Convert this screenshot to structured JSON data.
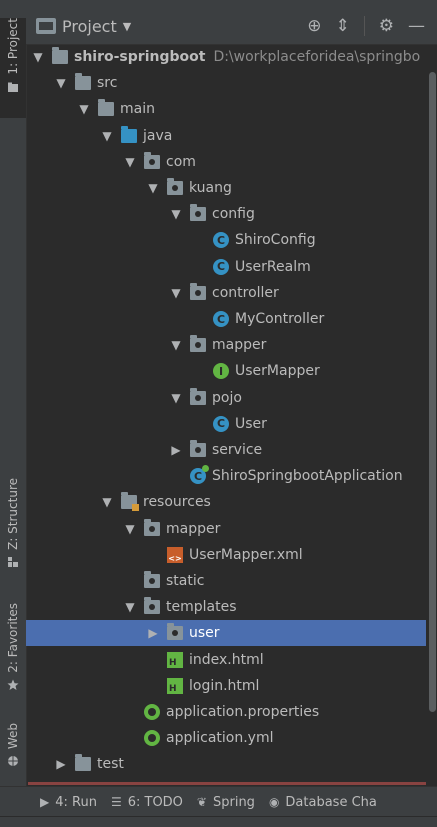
{
  "header": {
    "title": "Project",
    "actions": [
      "locate-icon",
      "collapse-icon",
      "settings-icon",
      "hide-icon"
    ]
  },
  "left_tabs": [
    {
      "label": "1: Project",
      "icon": "folder-icon"
    },
    {
      "label": "Z: Structure",
      "icon": "structure-icon"
    },
    {
      "label": "2: Favorites",
      "icon": "star-icon"
    },
    {
      "label": "Web",
      "icon": "globe-icon"
    }
  ],
  "tree": [
    {
      "label": "shiro-springboot",
      "extra": "D:\\workplaceforidea\\springbo",
      "depth": 0,
      "arrow": "open",
      "icon": "project"
    },
    {
      "label": "src",
      "depth": 1,
      "arrow": "open",
      "icon": "folder"
    },
    {
      "label": "main",
      "depth": 2,
      "arrow": "open",
      "icon": "folder"
    },
    {
      "label": "java",
      "depth": 3,
      "arrow": "open",
      "icon": "src"
    },
    {
      "label": "com",
      "depth": 4,
      "arrow": "open",
      "icon": "pkg"
    },
    {
      "label": "kuang",
      "depth": 5,
      "arrow": "open",
      "icon": "pkg"
    },
    {
      "label": "config",
      "depth": 6,
      "arrow": "open",
      "icon": "pkg"
    },
    {
      "label": "ShiroConfig",
      "depth": 7,
      "arrow": "none",
      "icon": "class"
    },
    {
      "label": "UserRealm",
      "depth": 7,
      "arrow": "none",
      "icon": "class"
    },
    {
      "label": "controller",
      "depth": 6,
      "arrow": "open",
      "icon": "pkg"
    },
    {
      "label": "MyController",
      "depth": 7,
      "arrow": "none",
      "icon": "class"
    },
    {
      "label": "mapper",
      "depth": 6,
      "arrow": "open",
      "icon": "pkg"
    },
    {
      "label": "UserMapper",
      "depth": 7,
      "arrow": "none",
      "icon": "interface"
    },
    {
      "label": "pojo",
      "depth": 6,
      "arrow": "open",
      "icon": "pkg"
    },
    {
      "label": "User",
      "depth": 7,
      "arrow": "none",
      "icon": "class"
    },
    {
      "label": "service",
      "depth": 6,
      "arrow": "closed",
      "icon": "pkg"
    },
    {
      "label": "ShiroSpringbootApplication",
      "depth": 6,
      "arrow": "none",
      "icon": "app"
    },
    {
      "label": "resources",
      "depth": 3,
      "arrow": "open",
      "icon": "res"
    },
    {
      "label": "mapper",
      "depth": 4,
      "arrow": "open",
      "icon": "pkg"
    },
    {
      "label": "UserMapper.xml",
      "depth": 5,
      "arrow": "none",
      "icon": "xml"
    },
    {
      "label": "static",
      "depth": 4,
      "arrow": "none",
      "icon": "pkg"
    },
    {
      "label": "templates",
      "depth": 4,
      "arrow": "open",
      "icon": "pkg"
    },
    {
      "label": "user",
      "depth": 5,
      "arrow": "closed",
      "icon": "pkg",
      "selected": true
    },
    {
      "label": "index.html",
      "depth": 5,
      "arrow": "none",
      "icon": "html"
    },
    {
      "label": "login.html",
      "depth": 5,
      "arrow": "none",
      "icon": "html"
    },
    {
      "label": "application.properties",
      "depth": 4,
      "arrow": "none",
      "icon": "props"
    },
    {
      "label": "application.yml",
      "depth": 4,
      "arrow": "none",
      "icon": "props"
    },
    {
      "label": "test",
      "depth": 1,
      "arrow": "closed",
      "icon": "folder"
    }
  ],
  "bottom_tabs": [
    {
      "label": "4: Run",
      "icon": "run-icon"
    },
    {
      "label": "6: TODO",
      "icon": "todo-icon"
    },
    {
      "label": "Spring",
      "icon": "spring-icon"
    },
    {
      "label": "Database Cha",
      "icon": "database-icon"
    }
  ]
}
